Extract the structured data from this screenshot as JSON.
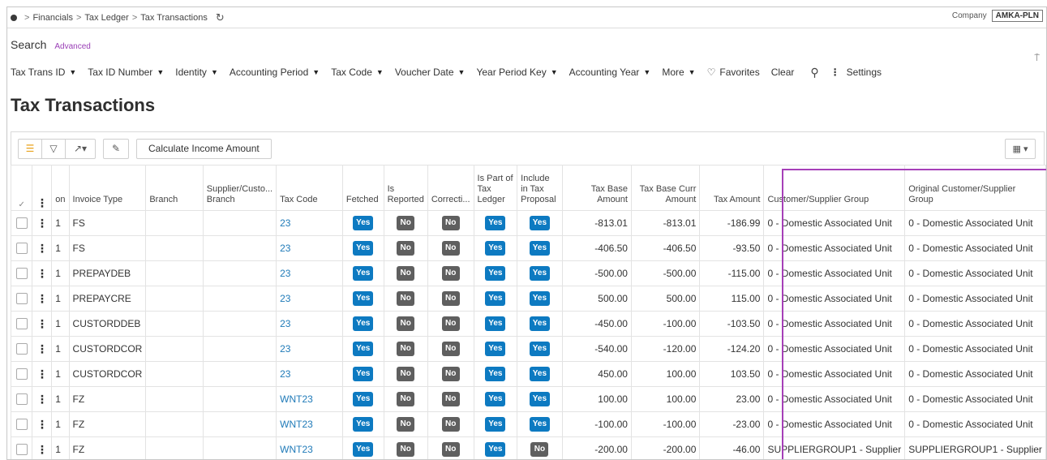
{
  "breadcrumb": {
    "items": [
      "Financials",
      "Tax Ledger",
      "Tax Transactions"
    ],
    "sep": ">"
  },
  "company": {
    "label": "Company",
    "value": "AMKA-PLN"
  },
  "search": {
    "title": "Search",
    "advanced": "Advanced"
  },
  "filters": {
    "items": [
      "Tax Trans ID",
      "Tax ID Number",
      "Identity",
      "Accounting Period",
      "Tax Code",
      "Voucher Date",
      "Year Period Key",
      "Accounting Year",
      "More"
    ],
    "favorites": "Favorites",
    "clear": "Clear",
    "settings": "Settings"
  },
  "page_title": "Tax Transactions",
  "toolbar": {
    "calc_label": "Calculate Income Amount"
  },
  "table": {
    "columns": {
      "col3": "on",
      "invoice_type": "Invoice Type",
      "branch": "Branch",
      "supp_branch": "Supplier/Custo... Branch",
      "tax_code": "Tax Code",
      "fetched": "Fetched",
      "reported": "Is Reported",
      "correction": "Correcti...",
      "part_ledger": "Is Part of Tax Ledger",
      "incl_proposal": "Include in Tax Proposal",
      "base_amount": "Tax Base Amount",
      "base_curr": "Tax Base Curr Amount",
      "tax_amount": "Tax Amount",
      "cs_group": "Customer/Supplier Group",
      "orig_group": "Original Customer/Supplier Group"
    },
    "rows": [
      {
        "n": "1",
        "inv": "FS",
        "code": "23",
        "fetched": "Yes",
        "reported": "No",
        "corr": "No",
        "part": "Yes",
        "incl": "Yes",
        "base": "-813.01",
        "curr": "-813.01",
        "tax": "-186.99",
        "grp": "0 - Domestic Associated Unit",
        "orig": "0 - Domestic Associated Unit"
      },
      {
        "n": "1",
        "inv": "FS",
        "code": "23",
        "fetched": "Yes",
        "reported": "No",
        "corr": "No",
        "part": "Yes",
        "incl": "Yes",
        "base": "-406.50",
        "curr": "-406.50",
        "tax": "-93.50",
        "grp": "0 - Domestic Associated Unit",
        "orig": "0 - Domestic Associated Unit"
      },
      {
        "n": "1",
        "inv": "PREPAYDEB",
        "code": "23",
        "fetched": "Yes",
        "reported": "No",
        "corr": "No",
        "part": "Yes",
        "incl": "Yes",
        "base": "-500.00",
        "curr": "-500.00",
        "tax": "-115.00",
        "grp": "0 - Domestic Associated Unit",
        "orig": "0 - Domestic Associated Unit"
      },
      {
        "n": "1",
        "inv": "PREPAYCRE",
        "code": "23",
        "fetched": "Yes",
        "reported": "No",
        "corr": "No",
        "part": "Yes",
        "incl": "Yes",
        "base": "500.00",
        "curr": "500.00",
        "tax": "115.00",
        "grp": "0 - Domestic Associated Unit",
        "orig": "0 - Domestic Associated Unit"
      },
      {
        "n": "1",
        "inv": "CUSTORDDEB",
        "code": "23",
        "fetched": "Yes",
        "reported": "No",
        "corr": "No",
        "part": "Yes",
        "incl": "Yes",
        "base": "-450.00",
        "curr": "-100.00",
        "tax": "-103.50",
        "grp": "0 - Domestic Associated Unit",
        "orig": "0 - Domestic Associated Unit"
      },
      {
        "n": "1",
        "inv": "CUSTORDCOR",
        "code": "23",
        "fetched": "Yes",
        "reported": "No",
        "corr": "No",
        "part": "Yes",
        "incl": "Yes",
        "base": "-540.00",
        "curr": "-120.00",
        "tax": "-124.20",
        "grp": "0 - Domestic Associated Unit",
        "orig": "0 - Domestic Associated Unit"
      },
      {
        "n": "1",
        "inv": "CUSTORDCOR",
        "code": "23",
        "fetched": "Yes",
        "reported": "No",
        "corr": "No",
        "part": "Yes",
        "incl": "Yes",
        "base": "450.00",
        "curr": "100.00",
        "tax": "103.50",
        "grp": "0 - Domestic Associated Unit",
        "orig": "0 - Domestic Associated Unit"
      },
      {
        "n": "1",
        "inv": "FZ",
        "code": "WNT23",
        "fetched": "Yes",
        "reported": "No",
        "corr": "No",
        "part": "Yes",
        "incl": "Yes",
        "base": "100.00",
        "curr": "100.00",
        "tax": "23.00",
        "grp": "0 - Domestic Associated Unit",
        "orig": "0 - Domestic Associated Unit"
      },
      {
        "n": "1",
        "inv": "FZ",
        "code": "WNT23",
        "fetched": "Yes",
        "reported": "No",
        "corr": "No",
        "part": "Yes",
        "incl": "Yes",
        "base": "-100.00",
        "curr": "-100.00",
        "tax": "-23.00",
        "grp": "0 - Domestic Associated Unit",
        "orig": "0 - Domestic Associated Unit"
      },
      {
        "n": "1",
        "inv": "FZ",
        "code": "WNT23",
        "fetched": "Yes",
        "reported": "No",
        "corr": "No",
        "part": "Yes",
        "incl": "No",
        "base": "-200.00",
        "curr": "-200.00",
        "tax": "-46.00",
        "grp": "SUPPLIERGROUP1 - Supplier",
        "orig": "SUPPLIERGROUP1 - Supplier"
      }
    ]
  },
  "colors": {
    "yes": "#0d7ac1",
    "no": "#5f5f5f",
    "link": "#1f7ab8",
    "highlight": "#a63fb8"
  }
}
